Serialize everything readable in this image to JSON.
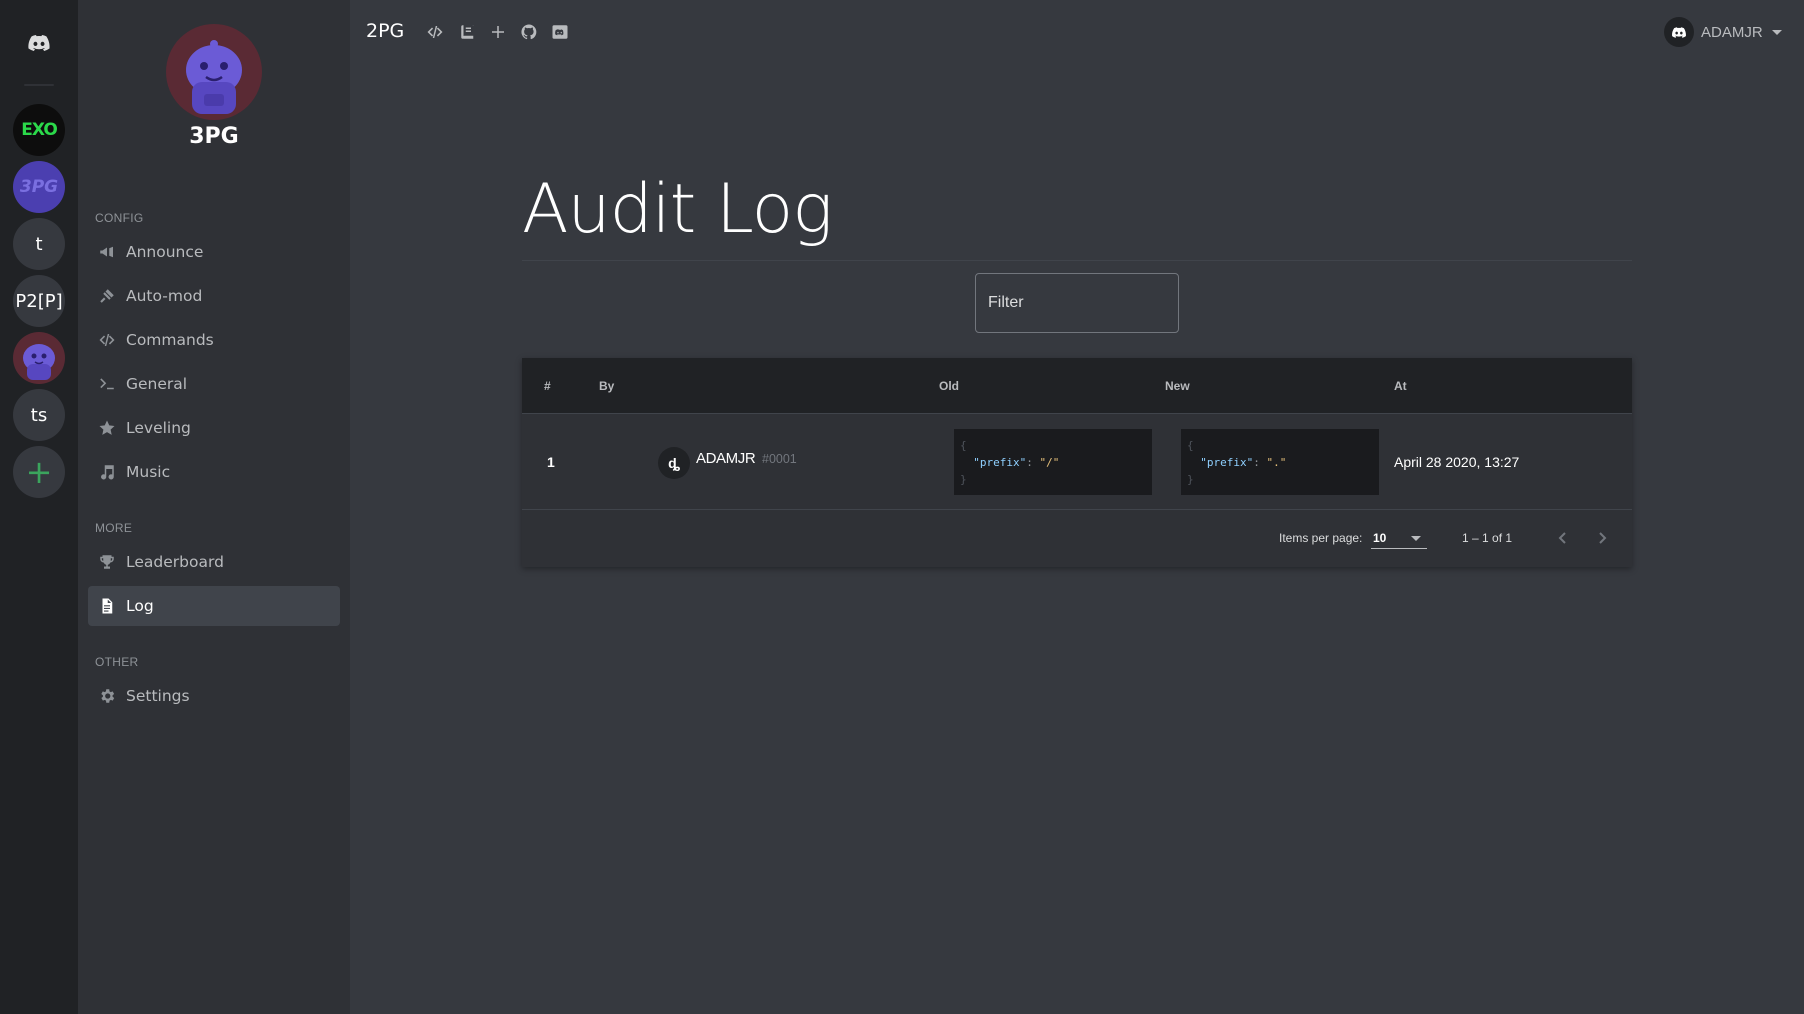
{
  "rail": {
    "guilds": [
      {
        "label": "EXO",
        "kind": "exo"
      },
      {
        "label": "3PG",
        "kind": "tpg"
      },
      {
        "label": "t",
        "kind": "text"
      },
      {
        "label": "P2[P]",
        "kind": "text"
      },
      {
        "label": "",
        "kind": "avatar"
      },
      {
        "label": "ts",
        "kind": "text"
      },
      {
        "label": "+",
        "kind": "add"
      }
    ]
  },
  "sidebar": {
    "bot_name": "3PG",
    "sections": {
      "config": "CONFIG",
      "more": "MORE",
      "other": "OTHER"
    },
    "items": {
      "announce": "Announce",
      "automod": "Auto-mod",
      "commands": "Commands",
      "general": "General",
      "leveling": "Leveling",
      "music": "Music",
      "leaderboard": "Leaderboard",
      "log": "Log",
      "settings": "Settings"
    },
    "active_item": "log"
  },
  "topbar": {
    "brand": "2PG",
    "icons": [
      "code-icon",
      "book-icon",
      "plus-icon",
      "github-icon",
      "discord-icon"
    ],
    "user": "ADAMJR"
  },
  "main": {
    "title": "Audit Log",
    "filter_placeholder": "Filter",
    "table": {
      "headers": {
        "num": "#",
        "by": "By",
        "old": "Old",
        "new": "New",
        "at": "At"
      },
      "rows": [
        {
          "num": "1",
          "by_avatar": "ȡ",
          "by_name": "ADAMJR",
          "by_disc": "#0001",
          "old": {
            "open": "{",
            "key": "\"prefix\"",
            "colon": ":",
            "value": "\"/\"",
            "close": "}"
          },
          "new": {
            "open": "{",
            "key": "\"prefix\"",
            "colon": ":",
            "value": "\".\"",
            "close": "}"
          },
          "at": "April 28 2020, 13:27"
        }
      ]
    },
    "paginator": {
      "items_per_page_label": "Items per page:",
      "items_per_page": "10",
      "range": "1 – 1 of 1"
    }
  },
  "colors": {
    "rail_bg": "#202225",
    "sidebar_bg": "#2f3136",
    "main_bg": "#36393f",
    "blurple": "#7289da",
    "exo_green": "#2bd94a"
  }
}
